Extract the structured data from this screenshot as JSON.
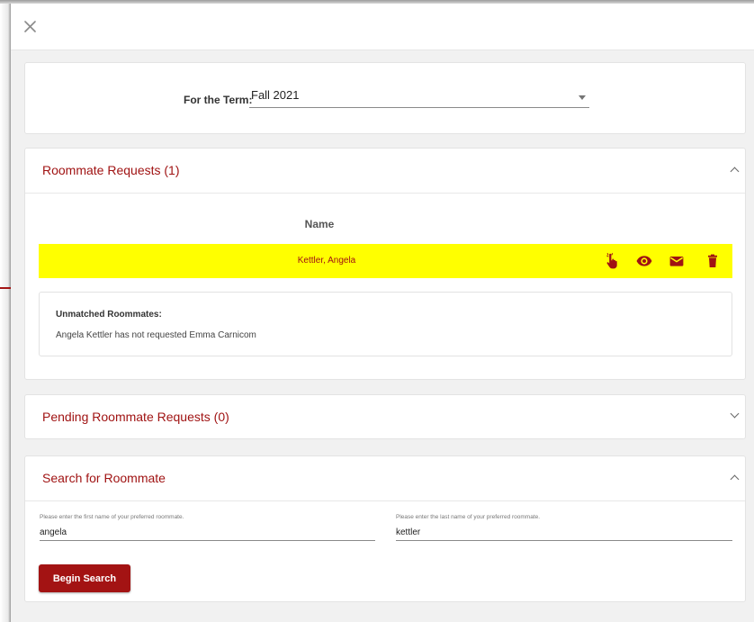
{
  "colors": {
    "accent": "#a01313",
    "highlight_row": "#ffff00",
    "button_bg": "#a31313"
  },
  "dialog": {
    "close_icon": "close-icon"
  },
  "term": {
    "label": "For the Term:",
    "selected": "Fall 2021"
  },
  "roommate_requests": {
    "title": "Roommate Requests (1)",
    "expanded": true,
    "column_header": "Name",
    "rows": [
      {
        "name": "Kettler, Angela",
        "actions": [
          "hand-pointer-icon",
          "eye-icon",
          "envelope-icon",
          "trash-icon"
        ]
      }
    ],
    "unmatched": {
      "title": "Unmatched Roommates:",
      "message": "Angela Kettler has not requested Emma Carnicom"
    }
  },
  "pending_requests": {
    "title": "Pending Roommate Requests (0)",
    "expanded": false
  },
  "search": {
    "title": "Search for Roommate",
    "expanded": true,
    "first_name_label": "Please enter the first name of your preferred roommate.",
    "first_name_value": "angela",
    "last_name_label": "Please enter the last name of your preferred roommate.",
    "last_name_value": "kettler",
    "button_label": "Begin Search"
  }
}
